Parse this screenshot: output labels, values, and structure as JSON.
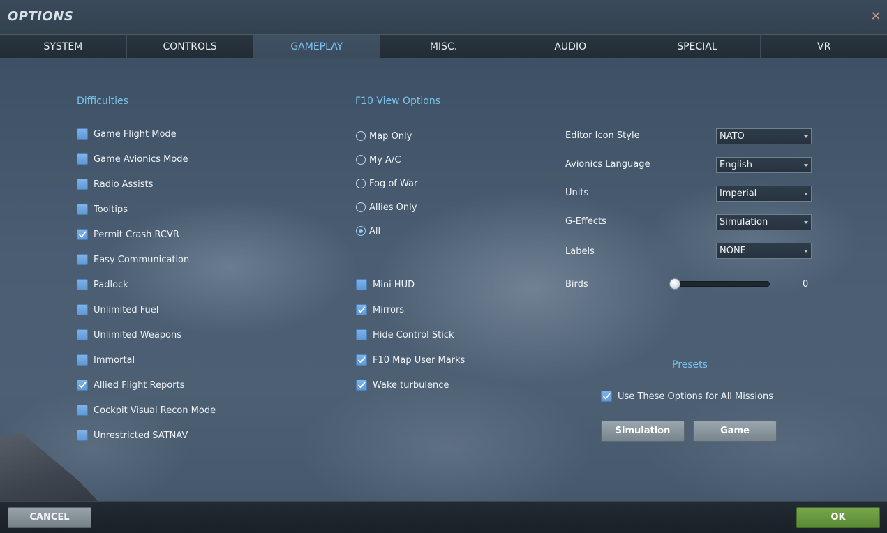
{
  "window": {
    "title": "OPTIONS",
    "close_symbol": "✕"
  },
  "tabs": [
    {
      "label": "SYSTEM",
      "active": false
    },
    {
      "label": "CONTROLS",
      "active": false
    },
    {
      "label": "GAMEPLAY",
      "active": true
    },
    {
      "label": "MISC.",
      "active": false
    },
    {
      "label": "AUDIO",
      "active": false
    },
    {
      "label": "SPECIAL",
      "active": false
    },
    {
      "label": "VR",
      "active": false
    }
  ],
  "difficulties": {
    "title": "Difficulties",
    "items": [
      {
        "label": "Game Flight Mode",
        "checked": false
      },
      {
        "label": "Game Avionics Mode",
        "checked": false
      },
      {
        "label": "Radio Assists",
        "checked": false
      },
      {
        "label": "Tooltips",
        "checked": false
      },
      {
        "label": "Permit Crash RCVR",
        "checked": true
      },
      {
        "label": "Easy Communication",
        "checked": false
      },
      {
        "label": "Padlock",
        "checked": false
      },
      {
        "label": "Unlimited Fuel",
        "checked": false
      },
      {
        "label": "Unlimited Weapons",
        "checked": false
      },
      {
        "label": "Immortal",
        "checked": false
      },
      {
        "label": "Allied Flight Reports",
        "checked": true
      },
      {
        "label": "Cockpit Visual Recon Mode",
        "checked": false
      },
      {
        "label": "Unrestricted SATNAV",
        "checked": false
      }
    ]
  },
  "f10_view": {
    "title": "F10 View Options",
    "options": [
      {
        "label": "Map Only",
        "selected": false
      },
      {
        "label": "My A/C",
        "selected": false
      },
      {
        "label": "Fog of War",
        "selected": false
      },
      {
        "label": "Allies Only",
        "selected": false
      },
      {
        "label": "All",
        "selected": true
      }
    ]
  },
  "view_checks": [
    {
      "label": "Mini HUD",
      "checked": false
    },
    {
      "label": "Mirrors",
      "checked": true
    },
    {
      "label": "Hide Control Stick",
      "checked": false
    },
    {
      "label": "F10 Map User Marks",
      "checked": true
    },
    {
      "label": "Wake turbulence",
      "checked": true
    }
  ],
  "settings": [
    {
      "label": "Editor Icon Style",
      "value": "NATO"
    },
    {
      "label": "Avionics Language",
      "value": "English"
    },
    {
      "label": "Units",
      "value": "Imperial"
    },
    {
      "label": "G-Effects",
      "value": "Simulation"
    },
    {
      "label": "Labels",
      "value": "NONE"
    }
  ],
  "birds": {
    "label": "Birds",
    "value": "0",
    "fraction": 0
  },
  "presets": {
    "title": "Presets",
    "use_for_all_label": "Use These Options for All Missions",
    "use_for_all_checked": true,
    "simulation_button": "Simulation",
    "game_button": "Game"
  },
  "footer": {
    "cancel_label": "CANCEL",
    "ok_label": "OK"
  },
  "colors": {
    "accent": "#79c2ec",
    "checkbox": "#6ea6df",
    "ok_green": "#6a9a40"
  },
  "icons": {
    "close": "close-icon",
    "check": "checkmark-icon",
    "dropdown": "chevron-down-icon"
  }
}
